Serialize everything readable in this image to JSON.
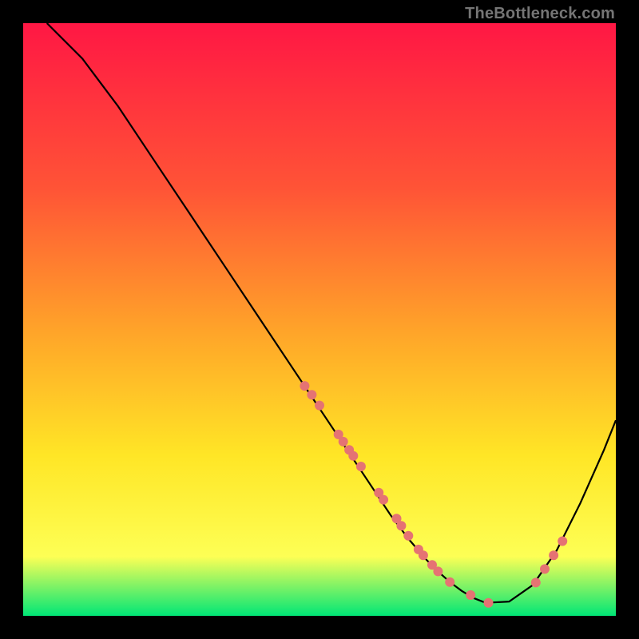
{
  "watermark": "TheBottleneck.com",
  "colors": {
    "grad_top": "#ff1744",
    "grad_mid1": "#ff5436",
    "grad_mid2": "#ffa429",
    "grad_mid3": "#ffe626",
    "grad_mid4": "#fdff55",
    "grad_bottom": "#00e676",
    "curve": "#000000",
    "dot": "#e57373"
  },
  "chart_data": {
    "type": "line",
    "title": "",
    "xlabel": "",
    "ylabel": "",
    "xlim": [
      0,
      100
    ],
    "ylim": [
      0,
      100
    ],
    "curve": {
      "x": [
        4,
        10,
        16,
        22,
        28,
        34,
        40,
        46,
        50,
        54,
        58,
        62,
        65,
        68,
        70,
        72,
        74,
        76,
        78,
        82,
        86,
        90,
        94,
        98,
        100
      ],
      "y": [
        100,
        94,
        86,
        77,
        68,
        59,
        50,
        41,
        35,
        29,
        23,
        17,
        13,
        9.5,
        7.5,
        5.7,
        4.2,
        3.0,
        2.2,
        2.4,
        5.2,
        11,
        19,
        28,
        33
      ]
    },
    "dots": {
      "x": [
        47.5,
        48.7,
        50.0,
        53.2,
        54.0,
        55.0,
        55.7,
        57.0,
        60.0,
        60.8,
        63.0,
        63.8,
        65.0,
        66.7,
        67.5,
        69.0,
        70.0,
        72.0,
        75.5,
        78.5,
        86.5,
        88.0,
        89.5,
        91.0
      ],
      "y": [
        38.8,
        37.3,
        35.5,
        30.6,
        29.4,
        28.0,
        27.0,
        25.2,
        20.8,
        19.6,
        16.4,
        15.2,
        13.5,
        11.2,
        10.2,
        8.6,
        7.5,
        5.7,
        3.5,
        2.2,
        5.6,
        7.9,
        10.2,
        12.6
      ]
    }
  }
}
